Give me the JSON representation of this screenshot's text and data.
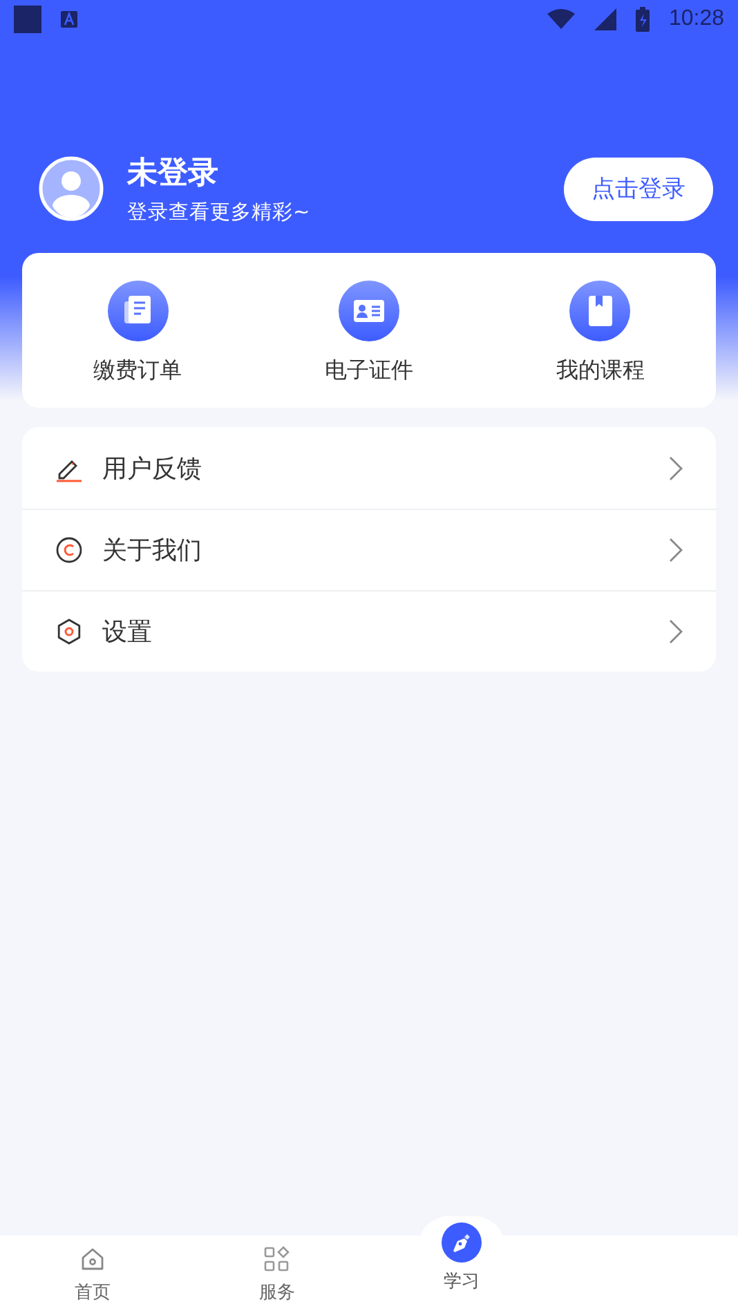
{
  "status_bar": {
    "time": "10:28"
  },
  "profile": {
    "name": "未登录",
    "subtitle": "登录查看更多精彩~",
    "login_button": "点击登录"
  },
  "shortcuts": [
    {
      "kind": "orders",
      "label": "缴费订单"
    },
    {
      "kind": "certificate",
      "label": "电子证件"
    },
    {
      "kind": "courses",
      "label": "我的课程"
    }
  ],
  "menu": [
    {
      "kind": "feedback",
      "label": "用户反馈"
    },
    {
      "kind": "about",
      "label": "关于我们"
    },
    {
      "kind": "settings",
      "label": "设置"
    }
  ],
  "tab_bar": [
    {
      "kind": "home",
      "label": "首页",
      "selected": false
    },
    {
      "kind": "services",
      "label": "服务",
      "selected": false
    },
    {
      "kind": "study",
      "label": "学习",
      "selected": true
    }
  ]
}
